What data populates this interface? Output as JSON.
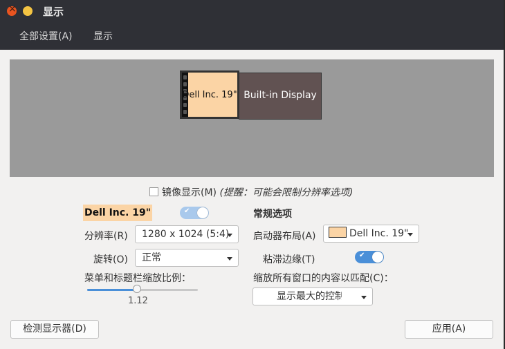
{
  "window": {
    "title": "显示"
  },
  "menubar": {
    "all_settings": "全部设置(A)",
    "display": "显示"
  },
  "preview": {
    "monitors": [
      {
        "name": "Dell Inc. 19\"",
        "color": "#fbd4a5"
      },
      {
        "name": "Built-in Display",
        "color": "#615252"
      }
    ]
  },
  "mirror": {
    "label": "镜像显示(M)",
    "hint": "(提醒：可能会限制分辨率选项)",
    "checked": false
  },
  "monitor_settings": {
    "title": "Dell Inc. 19\"",
    "enabled": true,
    "resolution_label": "分辨率(R)",
    "resolution_value": "1280 x 1024 (5:4)",
    "rotation_label": "旋转(O)",
    "rotation_value": "正常",
    "scale_label": "菜单和标题栏缩放比例：",
    "scale_value": "1.12",
    "scale_level_fraction": 0.45
  },
  "general": {
    "title": "常规选项",
    "launcher_label": "启动器布局(A)",
    "launcher_value": "Dell Inc. 19\"",
    "sticky_label": "粘滞边缘(T)",
    "sticky_enabled": true,
    "scale_all_label": "缩放所有窗口的内容以匹配(C)：",
    "scale_all_value": "显示最大的控制"
  },
  "buttons": {
    "detect": "检测显示器(D)",
    "apply": "应用(A)"
  },
  "colors": {
    "accent": "#4a8fd8",
    "titlebar": "#2f3036",
    "close": "#e95420",
    "minimize": "#f4c443"
  }
}
